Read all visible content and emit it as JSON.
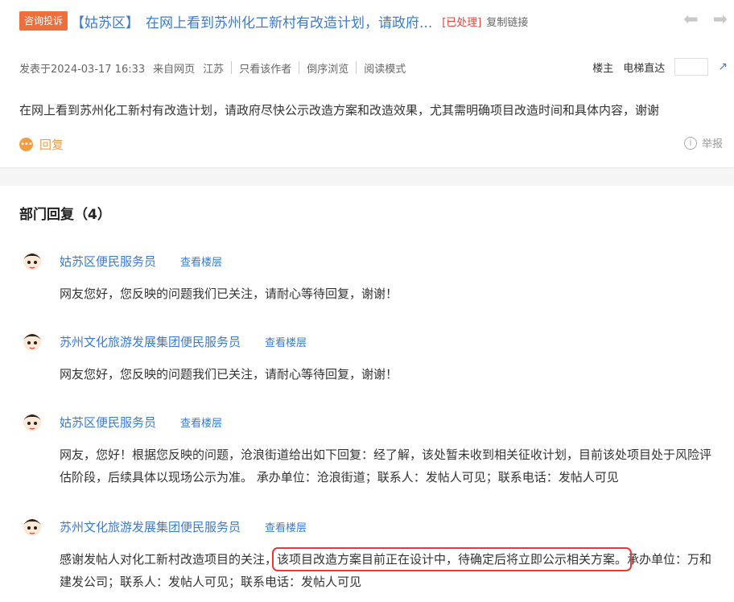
{
  "header": {
    "badge": "咨询投诉",
    "district": "【姑苏区】",
    "title": "在网上看到苏州化工新村有改造计划，请政府...",
    "status": "[已处理]",
    "copy_link": "复制链接"
  },
  "meta": {
    "posted": "发表于2024-03-17 16:33",
    "source": "来自网页",
    "region": "江苏",
    "author_only": "只看该作者",
    "reverse": "倒序浏览",
    "reading_mode": "阅读模式",
    "owner": "楼主",
    "elevator": "电梯直达",
    "elevator_placeholder": ""
  },
  "post": {
    "content": "在网上看到苏州化工新村有改造计划，请政府尽快公示改造方案和改造效果，尤其需明确项目改造时间和具体内容，谢谢",
    "reply_label": "回复",
    "report_label": "举报"
  },
  "dept": {
    "title": "部门回复（4）",
    "view_floor": "查看楼层",
    "replies": [
      {
        "name": "姑苏区便民服务员",
        "text": "网友您好，您反映的问题我们已关注，请耐心等待回复，谢谢！"
      },
      {
        "name": "苏州文化旅游发展集团便民服务员",
        "text": "网友您好，您反映的问题我们已关注，请耐心等待回复，谢谢！"
      },
      {
        "name": "姑苏区便民服务员",
        "text": "网友，您好！根据您反映的问题，沧浪街道给出如下回复：经了解，该处暂未收到相关征收计划，目前该处项目处于风险评估阶段，后续具体以现场公示为准。 承办单位：沧浪街道；联系人：发帖人可见；联系电话：发帖人可见"
      },
      {
        "name": "苏州文化旅游发展集团便民服务员",
        "text_before": "感谢发帖人对化工新村改造项目的关注，",
        "text_highlight": "该项目改造方案目前正在设计中，待确定后将立即公示相关方案。",
        "text_after": "承办单位：万和建发公司；联系人：发帖人可见；联系电话：发帖人可见"
      }
    ]
  },
  "colors": {
    "accent_blue": "#3a7bd5",
    "badge_orange": "#ee6e3c",
    "status_red": "#e2463d",
    "highlight_red": "#e53935",
    "reply_orange": "#f09e45"
  }
}
